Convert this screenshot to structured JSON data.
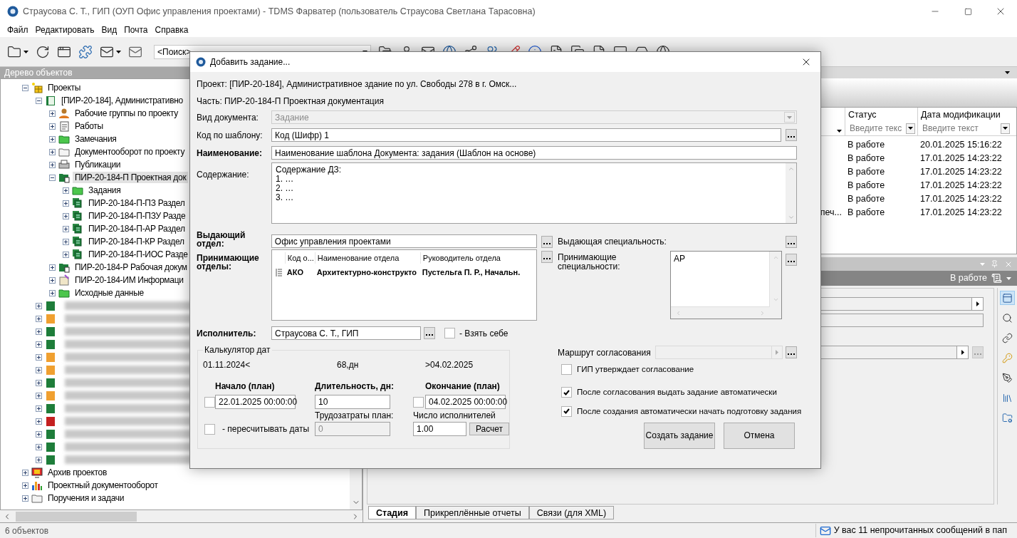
{
  "window": {
    "title": "Страусова С. Т., ГИП (ОУП Офис управления проектами) - TDMS Фарватер (пользователь Страусова Светлана Тарасовна)"
  },
  "menu": [
    "Файл",
    "Редактировать",
    "Вид",
    "Почта",
    "Справка"
  ],
  "toolbar": {
    "search_value": "<Поиск>"
  },
  "tree_panel": {
    "title": "Дерево объектов",
    "items": [
      {
        "label": "Проекты",
        "kind": "projects",
        "expanded": true,
        "selected": false,
        "children": [
          {
            "label": "[ПИР-20-184], Административно",
            "kind": "project",
            "expanded": true,
            "selected": false,
            "children": [
              {
                "label": "Рабочие группы по проекту",
                "kind": "people",
                "expanded": false,
                "selected": false
              },
              {
                "label": "Работы",
                "kind": "works",
                "expanded": false,
                "selected": false
              },
              {
                "label": "Замечания",
                "kind": "folder_green",
                "expanded": false,
                "selected": false
              },
              {
                "label": "Документооборот по проекту",
                "kind": "folder",
                "expanded": false,
                "selected": false
              },
              {
                "label": "Публикации",
                "kind": "print",
                "expanded": false,
                "selected": false
              },
              {
                "label": "ПИР-20-184-П Проектная док",
                "kind": "doc_part",
                "expanded": true,
                "selected": true,
                "children": [
                  {
                    "label": "Задания",
                    "kind": "folder_green",
                    "expanded": false,
                    "selected": false
                  },
                  {
                    "label": "ПИР-20-184-П-ПЗ Раздел",
                    "kind": "section",
                    "expanded": false,
                    "selected": false
                  },
                  {
                    "label": "ПИР-20-184-П-ПЗУ Разде",
                    "kind": "section",
                    "expanded": false,
                    "selected": false
                  },
                  {
                    "label": "ПИР-20-184-П-АР Раздел",
                    "kind": "section",
                    "expanded": false,
                    "selected": false
                  },
                  {
                    "label": "ПИР-20-184-П-КР Раздел",
                    "kind": "section",
                    "expanded": false,
                    "selected": false
                  },
                  {
                    "label": "ПИР-20-184-П-ИОС Разде",
                    "kind": "section",
                    "expanded": false,
                    "selected": false
                  }
                ]
              },
              {
                "label": "ПИР-20-184-Р Рабочая докум",
                "kind": "doc_part",
                "expanded": false,
                "selected": false
              },
              {
                "label": "ПИР-20-184-ИМ Информаци",
                "kind": "info",
                "expanded": false,
                "selected": false
              },
              {
                "label": "Исходные данные",
                "kind": "folder_green",
                "expanded": false,
                "selected": false
              }
            ]
          },
          {
            "kind": "redacted",
            "color": "#1e7d3a",
            "expanded": false
          },
          {
            "kind": "redacted",
            "color": "#f0a030",
            "expanded": false
          },
          {
            "kind": "redacted",
            "color": "#1e7d3a",
            "expanded": false
          },
          {
            "kind": "redacted",
            "color": "#1e7d3a",
            "expanded": false
          },
          {
            "kind": "redacted",
            "color": "#f0a030",
            "expanded": false
          },
          {
            "kind": "redacted",
            "color": "#f0a030",
            "expanded": false
          },
          {
            "kind": "redacted",
            "color": "#1e7d3a",
            "expanded": false
          },
          {
            "kind": "redacted",
            "color": "#f0a030",
            "expanded": false
          },
          {
            "kind": "redacted",
            "color": "#1e7d3a",
            "expanded": false
          },
          {
            "kind": "redacted",
            "color": "#c42020",
            "expanded": false
          },
          {
            "kind": "redacted",
            "color": "#1e7d3a",
            "expanded": false
          },
          {
            "kind": "redacted",
            "color": "#1e7d3a",
            "expanded": false
          },
          {
            "kind": "redacted",
            "color": "#1e7d3a",
            "expanded": false
          }
        ]
      },
      {
        "label": "Архив проектов",
        "kind": "archive",
        "expanded": false,
        "selected": false
      },
      {
        "label": "Проектный документооборот",
        "kind": "chart",
        "expanded": false,
        "selected": false
      },
      {
        "label": "Поручения и задачи",
        "kind": "folder",
        "expanded": false,
        "selected": false
      }
    ]
  },
  "table": {
    "columns": [
      {
        "label": "Статус",
        "filter_placeholder": "Введите текс"
      },
      {
        "label": "Дата модификации",
        "filter_placeholder": "Введите текст"
      }
    ],
    "rows": [
      {
        "status": "В работе",
        "date": "20.01.2025 15:16:22"
      },
      {
        "status": "В работе",
        "date": "17.01.2025 14:23:22"
      },
      {
        "status": "В работе",
        "date": "17.01.2025 14:23:22"
      },
      {
        "status": "В работе",
        "date": "17.01.2025 14:23:22"
      },
      {
        "status": "В работе",
        "date": "17.01.2025 14:23:22"
      },
      {
        "column_1": "печ...",
        "status": "В работе",
        "date": "17.01.2025 14:23:22"
      }
    ]
  },
  "detail_panel": {
    "status": "В работе",
    "side_tools": [
      {
        "kind": "details",
        "selected": true
      },
      {
        "kind": "search",
        "selected": false
      },
      {
        "kind": "link",
        "selected": false
      },
      {
        "kind": "key",
        "selected": false
      },
      {
        "kind": "pen",
        "selected": false
      },
      {
        "kind": "books",
        "selected": false
      },
      {
        "kind": "folder_gear",
        "selected": false
      }
    ]
  },
  "bottom_tabs": [
    {
      "label": "Стадия",
      "selected": true
    },
    {
      "label": "Прикреплённые отчеты",
      "selected": false
    },
    {
      "label": "Связи (для XML)",
      "selected": false
    }
  ],
  "status_bar": {
    "count": "6 объектов",
    "message": "У вас 11 непрочитанных сообщений в пап"
  },
  "dialog": {
    "title": "Добавить задание...",
    "project_line": "Проект: [ПИР-20-184], Административное здание по ул. Свободы 278 в г. Омск...",
    "part_line": "Часть: ПИР-20-184-П Проектная документация",
    "doc_type": {
      "label": "Вид документа:",
      "value": "Задание",
      "disabled": true
    },
    "template_code": {
      "label": "Код по шаблону:",
      "value": "Код (Шифр) 1"
    },
    "name": {
      "label": "Наименование:",
      "value": "Наименование шаблона Документа: задания (Шаблон на основе)",
      "required": true
    },
    "content": {
      "label": "Содержание:",
      "lines": [
        "Содержание ДЗ:",
        "1. …",
        "2. …",
        "3. …"
      ]
    },
    "issuing_dept": {
      "label": "Выдающий отдел:",
      "value": "Офис управления проектами",
      "required": true
    },
    "issuing_specialty": {
      "label": "Выдающая специальность:"
    },
    "receiving_depts": {
      "label": "Принимающие отделы:",
      "required": true,
      "columns": [
        "Код о...",
        "Наименование отдела",
        "Руководитель отдела"
      ],
      "rows": [
        {
          "code": "АКО",
          "name": "Архитектурно-конструкто",
          "head": "Пустельга П. Р., Начальн."
        }
      ]
    },
    "receiving_specialties": {
      "label": "Принимающие специальности:",
      "items": [
        "АР"
      ]
    },
    "executor": {
      "label": "Исполнитель:",
      "value": "Страусова С. Т., ГИП",
      "required": true,
      "take_self": {
        "label": "- Взять себе",
        "checked": false
      }
    },
    "calculator": {
      "title": "Калькулятор дат",
      "range_start": "01.11.2024<",
      "range_days": "68,дн",
      "range_end": ">04.02.2025",
      "start": {
        "label": "Начало (план)",
        "value": "22.01.2025 00:00:00",
        "checked": false
      },
      "duration": {
        "label": "Длительность, дн:",
        "value": "10"
      },
      "end": {
        "label": "Окончание (план)",
        "value": "04.02.2025 00:00:00",
        "checked": false
      },
      "recalc": {
        "label": "- пересчитывать даты",
        "checked": false
      },
      "labor": {
        "label": "Трудозатраты план:",
        "value": "0",
        "disabled": true
      },
      "performers": {
        "label": "Число исполнителей",
        "value": "1.00"
      },
      "calc_button": "Расчет"
    },
    "route": {
      "label": "Маршрут согласования"
    },
    "options": [
      {
        "label": "ГИП утверждает согласование",
        "checked": false
      },
      {
        "label": "После согласования выдать задание автоматически",
        "checked": true
      },
      {
        "label": "После создания автоматически начать подготовку задания",
        "checked": true
      }
    ],
    "buttons": [
      "Создать задание",
      "Отмена"
    ]
  }
}
